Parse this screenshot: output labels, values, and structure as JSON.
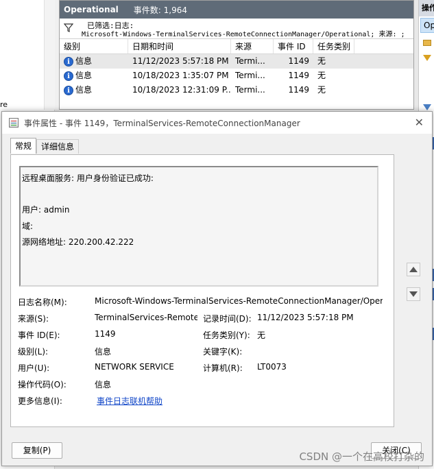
{
  "background": {
    "left_text": "re",
    "log_name": "Operational",
    "event_count": "事件数: 1,964",
    "filter_line1": "已筛选:日志:",
    "filter_line2": "Microsoft-Windows-TerminalServices-RemoteConnectionManager/Operational; 来源: ;",
    "columns": [
      "级别",
      "日期和时间",
      "来源",
      "事件 ID",
      "任务类别"
    ],
    "rows": [
      {
        "level": "信息",
        "datetime": "11/12/2023 5:57:18 PM",
        "source": "Termi...",
        "id": "1149",
        "task": "无"
      },
      {
        "level": "信息",
        "datetime": "10/18/2023 1:35:07 PM",
        "source": "Termi...",
        "id": "1149",
        "task": "无"
      },
      {
        "level": "信息",
        "datetime": "10/18/2023 12:31:09 P...",
        "source": "Termi...",
        "id": "1149",
        "task": "无"
      }
    ],
    "right_header": "操作",
    "right_selected": "Op"
  },
  "dialog": {
    "title": "事件属性 - 事件 1149，TerminalServices-RemoteConnectionManager",
    "tabs": [
      "常规",
      "详细信息"
    ],
    "description": {
      "line1": "远程桌面服务: 用户身份验证已成功:",
      "line2": "",
      "line3": "用户: admin",
      "line4": "域:",
      "line5": "源网络地址: 220.200.42.222"
    },
    "fields": {
      "log_name_label": "日志名称(M):",
      "log_name_value": "Microsoft-Windows-TerminalServices-RemoteConnectionManager/Oper",
      "source_label": "来源(S):",
      "source_value": "TerminalServices-Remote(",
      "logged_label": "记录时间(D):",
      "logged_value": "11/12/2023 5:57:18 PM",
      "event_id_label": "事件 ID(E):",
      "event_id_value": "1149",
      "task_label": "任务类别(Y):",
      "task_value": "无",
      "level_label": "级别(L):",
      "level_value": "信息",
      "keywords_label": "关键字(K):",
      "keywords_value": "",
      "user_label": "用户(U):",
      "user_value": "NETWORK SERVICE",
      "computer_label": "计算机(R):",
      "computer_value": "LT0073",
      "opcode_label": "操作代码(O):",
      "opcode_value": "信息",
      "more_info_label": "更多信息(I):",
      "more_info_link": "事件日志联机帮助"
    },
    "copy_button": "复制(P)",
    "close_button": "关闭(C)"
  },
  "watermark": "CSDN @一个在高校打杂的"
}
